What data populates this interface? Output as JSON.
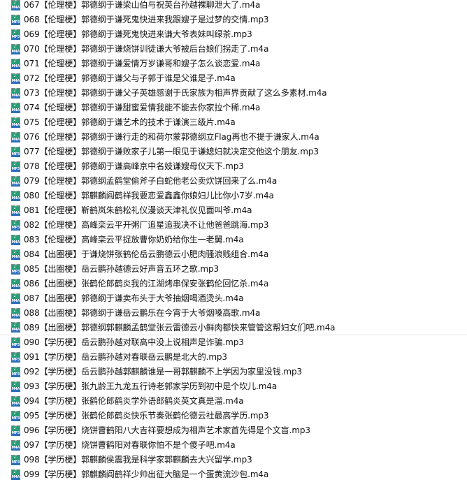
{
  "file_list": {
    "rows": [
      {
        "name": "067【伦理梗】郭德纲于谦梁山伯与祝英台孙越裸聊泄大了.m4a",
        "type": "M4A",
        "selected": false
      },
      {
        "name": "068【伦理梗】郭德纲于谦死鬼快进来我跟嫂子是过梦的交情.mp3",
        "type": "MP3",
        "selected": false
      },
      {
        "name": "069【伦理梗】郭德纲于谦死鬼快进来谦大爷表妹叫绿茶.mp3",
        "type": "MP3",
        "selected": false
      },
      {
        "name": "070【伦理梗】郭德纲于谦烧饼训徒谦大爷被后台娘们拐走了.m4a",
        "type": "M4A",
        "selected": false
      },
      {
        "name": "071【伦理梗】郭德纲于谦爱情万岁谦哥和嫂子怎么谈恋爱.m4a",
        "type": "M4A",
        "selected": false
      },
      {
        "name": "072【伦理梗】郭德纲于谦父与子郭于谁是父谁是子.m4a",
        "type": "M4A",
        "selected": false
      },
      {
        "name": "073【伦理梗】郭德纲于谦父子英雄感谢于氏家族为相声界贡献了这么多素材.m4a",
        "type": "M4A",
        "selected": false
      },
      {
        "name": "074【伦理梗】郭德纲于谦甜蜜爱情我能不能去你家拉个稀.m4a",
        "type": "M4A",
        "selected": false
      },
      {
        "name": "075【伦理梗】郭德纲于谦艺术的技术于谦演三级片.m4a",
        "type": "M4A",
        "selected": false
      },
      {
        "name": "076【伦理梗】郭德纲于谦行走的和荷尔蒙郭德纲立Flag再也不提于谦家人.m4a",
        "type": "M4A",
        "selected": false
      },
      {
        "name": "077【伦理梗】郭德纲于谦败家子儿第一眼见于谦媳妇就决定交他这个朋友.mp3",
        "type": "MP3",
        "selected": false
      },
      {
        "name": "078【伦理梗】郭德纲于谦高峰京中名妓谦嫂母仪天下.mp3",
        "type": "MP3",
        "selected": false
      },
      {
        "name": "079【伦理梗】郭德纲孟鹤堂偷斧子白蛇他老公卖炊饼回来了么.m4a",
        "type": "M4A",
        "selected": false
      },
      {
        "name": "080【伦理梗】郭麒麟阎鹤祥我要恋爱鑫鑫你娘妇儿比你小7岁.m4a",
        "type": "M4A",
        "selected": false
      },
      {
        "name": "081【伦理梗】靳鹤岚朱鹤松礼仪漫谈天津礼仪见面叫爷.m4a",
        "type": "M4A",
        "selected": false
      },
      {
        "name": "082【伦理梗】高峰栾云平开粥厂追星追我决不让他爸爸跳海.mp3",
        "type": "MP3",
        "selected": false
      },
      {
        "name": "083【伦理梗】高峰栾云平捉放曹你奶奶给你生一老舅.m4a",
        "type": "M4A",
        "selected": false
      },
      {
        "name": "084【出圈梗】于谦烧饼张鹤伦岳云鹏德云小肥肉骚浪贱组合.m4a",
        "type": "M4A",
        "selected": false
      },
      {
        "name": "085【出圈梗】岳云鹏孙越德云好声音五环之歌.mp3",
        "type": "MP3",
        "selected": false
      },
      {
        "name": "086【出圈梗】张鹤伦郎鹤炎我的江湖烤串保安张鹤伦回忆杀.m4a",
        "type": "M4A",
        "selected": false
      },
      {
        "name": "087【出圈梗】郭德纲于谦卖布头于大爷抽烟喝酒烫头.m4a",
        "type": "M4A",
        "selected": false
      },
      {
        "name": "088【出圈梗】郭德纲于谦岳云鹏乐在今宵于大爷烟嗓高歌.m4a",
        "type": "M4A",
        "selected": false
      },
      {
        "name": "089【出圈梗】郭德纲郭麒麟孟鹤堂张云雷德云小鲜肉都快来管管这帮妇女们吧.m4a",
        "type": "M4A",
        "selected": true
      },
      {
        "name": "090【学历梗】岳云鹏孙越对联高中没上说相声是诈骗.mp3",
        "type": "MP3",
        "selected": false
      },
      {
        "name": "091【学历梗】岳云鹏孙越对春联岳云鹏是北大的.mp3",
        "type": "MP3",
        "selected": false
      },
      {
        "name": "092【学历梗】岳云鹏孙越郭麒麟谁是一哥郭麒麟不上学因为家里没钱.mp3",
        "type": "MP3",
        "selected": false
      },
      {
        "name": "093【学历梗】张九龄王九龙五行诗老郭家学历到初中是个坎儿.m4a",
        "type": "M4A",
        "selected": false
      },
      {
        "name": "094【学历梗】张鹤伦郎鹤炎学外语郎鹤炎英文真是溜.m4a",
        "type": "M4A",
        "selected": false
      },
      {
        "name": "095【学历梗】张鹤伦郎鹤炎快乐节奏张鹤伦德云社最高学历.mp3",
        "type": "MP3",
        "selected": false
      },
      {
        "name": "096【学历梗】烧饼曹鹤阳八大吉祥要想成为相声艺术家首先得是个文盲.mp3",
        "type": "MP3",
        "selected": false
      },
      {
        "name": "097【学历梗】烧饼曹鹤阳对春联你怕不是个傻子吧.m4a",
        "type": "M4A",
        "selected": false
      },
      {
        "name": "098【学历梗】郭麒麟侯震我是科学家郭麒麟去大兴留学.mp3",
        "type": "MP3",
        "selected": false
      },
      {
        "name": "099【学历梗】郭麒麟阎鹤祥少帅出征大脑是一个蛋黄流沙包.m4a",
        "type": "M4A",
        "selected": false
      }
    ]
  }
}
